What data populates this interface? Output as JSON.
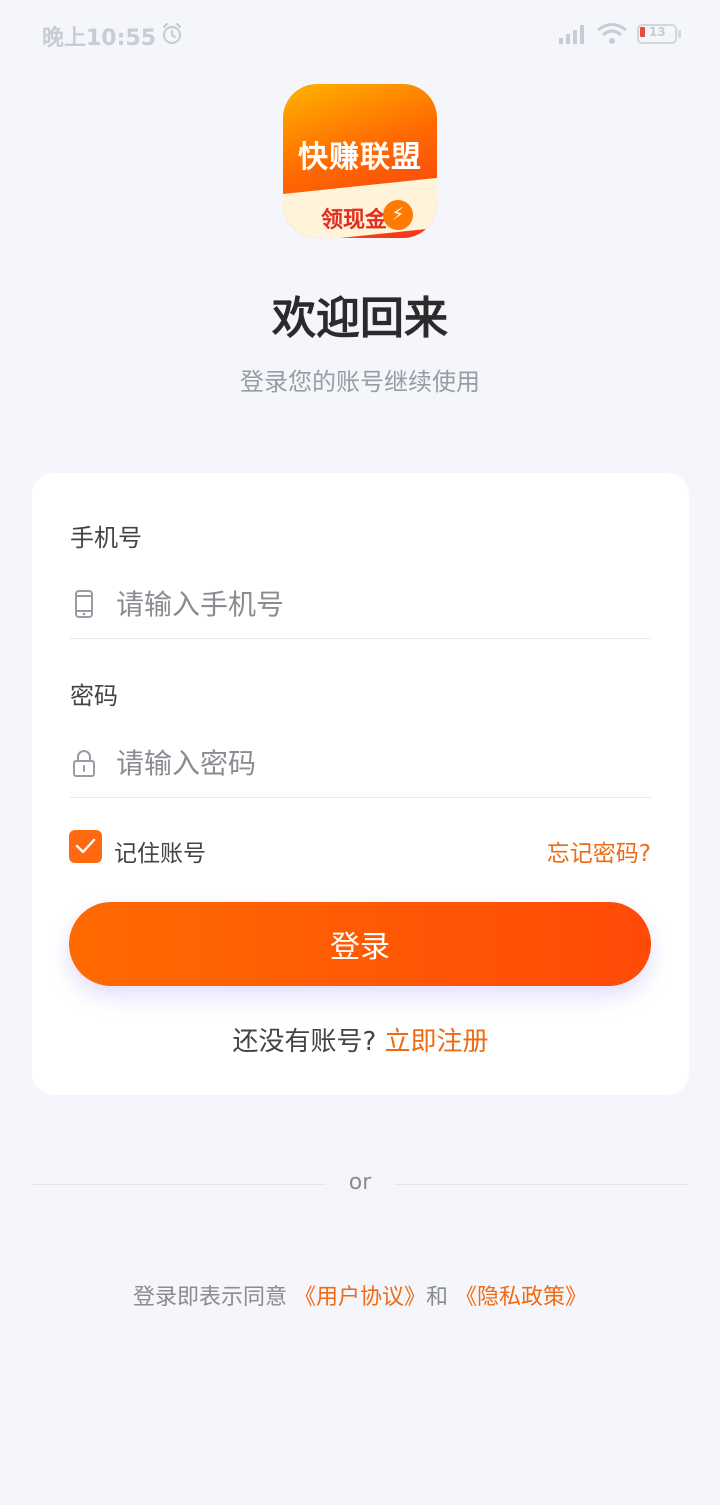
{
  "status_bar": {
    "time": "晚上10:55",
    "battery": "13"
  },
  "logo": {
    "top_text": "快赚联盟",
    "bottom_text": "领现金",
    "bolt": "⚡"
  },
  "header": {
    "title": "欢迎回来",
    "subtitle": "登录您的账号继续使用"
  },
  "form": {
    "phone_label": "手机号",
    "phone_placeholder": "请输入手机号",
    "phone_value": "",
    "password_label": "密码",
    "password_placeholder": "请输入密码",
    "password_value": "",
    "remember_label": "记住账号",
    "remember_checked": true,
    "forgot_label": "忘记密码?",
    "login_label": "登录",
    "no_account_text": "还没有账号?",
    "register_label": "立即注册"
  },
  "divider": {
    "text": "or"
  },
  "agreement": {
    "prefix": "登录即表示同意",
    "user_agreement": "《用户协议》",
    "and": "和",
    "privacy_policy": "《隐私政策》"
  },
  "colors": {
    "accent": "#ff6a10",
    "link": "#f06a12",
    "background": "#f4f6fb"
  }
}
